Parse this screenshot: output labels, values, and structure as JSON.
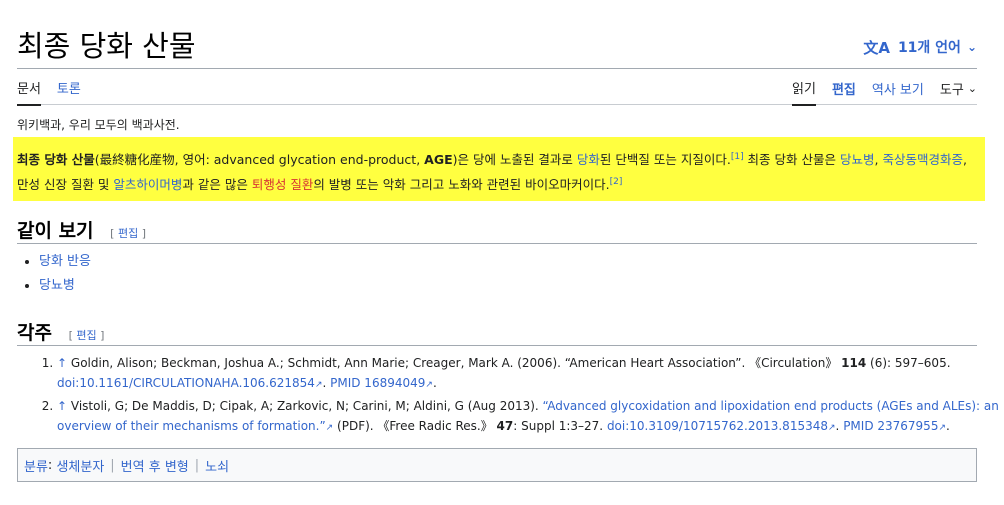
{
  "page": {
    "title": "최종 당화 산물",
    "lang_button": "11개 언어",
    "lang_glyph": "文A",
    "tagline": "위키백과, 우리 모두의 백과사전."
  },
  "tabs": {
    "left": [
      "문서",
      "토론"
    ],
    "right": {
      "read": "읽기",
      "edit": "편집",
      "history": "역사 보기",
      "tools": "도구"
    }
  },
  "lead": {
    "term": "최종 당화 산물",
    "hanja": "最終糖化産物",
    "english_prefix": ", 영어: advanced glycation end-product, ",
    "abbr": "AGE",
    "text1": ")은 당에 노출된 결과로 ",
    "link1": "당화",
    "text2": "된 단백질 또는 지질이다.",
    "ref1": "[1]",
    "text3": " 최종 당화 산물은 ",
    "link2": "당뇨병",
    "text4": ", ",
    "link3": "죽상동맥경화증",
    "text5": ", 만성 신장 질환 및 ",
    "link4": "알츠하이머병",
    "text6": "과 같은 많은 ",
    "link5": "퇴행성 질환",
    "text7": "의 발병 또는 악화 그리고 노화와 관련된 바이오마커이다.",
    "ref2": "[2]"
  },
  "sections": {
    "see_also": {
      "title": "같이 보기",
      "edit": "편집",
      "items": [
        "당화 반응",
        "당뇨병"
      ]
    },
    "refs": {
      "title": "각주",
      "edit": "편집"
    }
  },
  "references": [
    {
      "arrow": "↑",
      "authors": "Goldin, Alison; Beckman, Joshua A.; Schmidt, Ann Marie; Creager, Mark A. (2006). “American Heart Association”. 《Circulation》 ",
      "volume": "114",
      "rest": " (6): 597–605.",
      "doi": "doi:10.1161/CIRCULATIONAHA.106.621854",
      "pmid": "PMID 16894049"
    },
    {
      "arrow": "↑",
      "authors": "Vistoli, G; De Maddis, D; Cipak, A; Zarkovic, N; Carini, M; Aldini, G (Aug 2013). ",
      "title_link": "“Advanced glycoxidation and lipoxidation end products (AGEs and ALEs): an overview of their mechanisms of formation.”",
      "pdf": " (PDF). 《Free Radic Res.》 ",
      "volume": "47",
      "rest": ": Suppl 1:3–27. ",
      "doi": "doi:10.3109/10715762.2013.815348",
      "pmid": "PMID 23767955"
    }
  ],
  "categories": {
    "label": "분류",
    "items": [
      "생체분자",
      "번역 후 변형",
      "노쇠"
    ]
  }
}
